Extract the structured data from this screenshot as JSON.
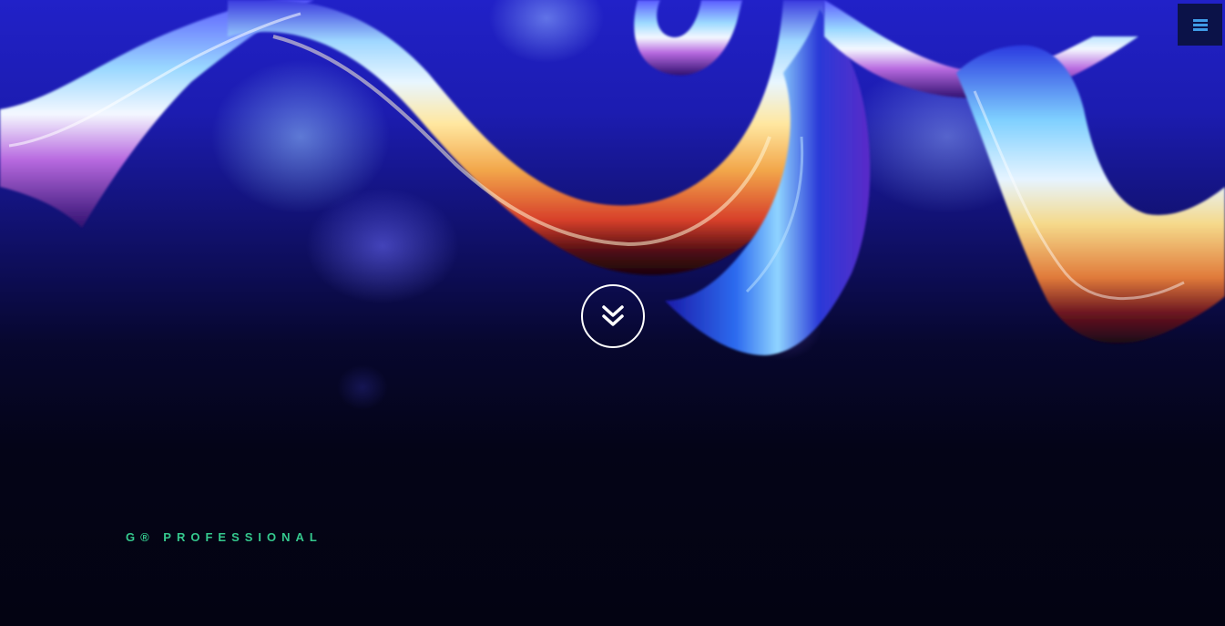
{
  "brand": {
    "text": "G® PROFESSIONAL",
    "color": "#35c98e"
  },
  "menu_button": {
    "icon": "hamburger-menu-icon",
    "color": "#3f9be6"
  },
  "scroll_button": {
    "icon": "double-chevron-down-icon"
  },
  "colors": {
    "background_top": "#2121c8",
    "background_bottom": "#030312"
  }
}
